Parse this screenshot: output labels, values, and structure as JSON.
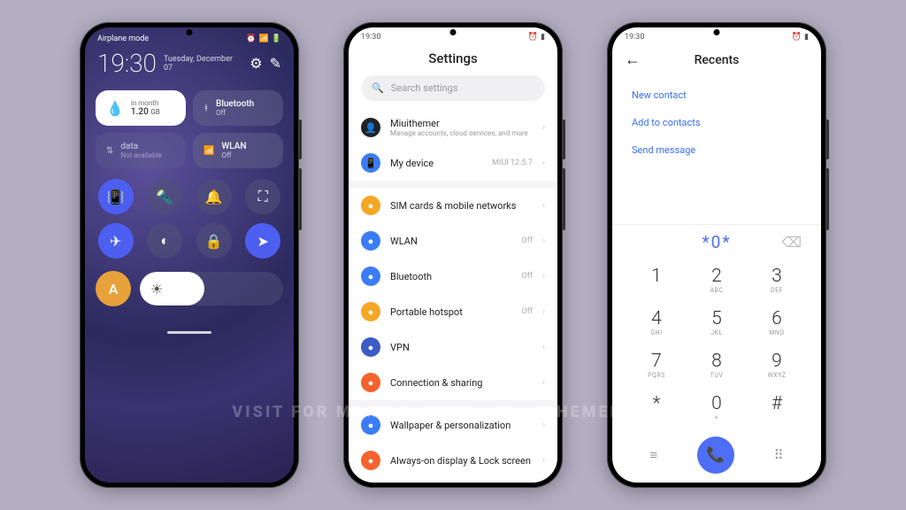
{
  "watermark": "VISIT FOR MORE THEMES - MIUITHEMER.COM",
  "p1": {
    "status_label": "Airplane mode",
    "clock": "19:30",
    "date": "Tuesday, December 07",
    "tiles": {
      "data": {
        "period": "in month",
        "value": "1.20",
        "unit": "GB"
      },
      "bluetooth": {
        "label": "Bluetooth",
        "state": "Off"
      },
      "mobile": {
        "label": "data",
        "state": "Not available"
      },
      "wlan": {
        "label": "WLAN",
        "state": "Off"
      }
    },
    "avatar_letter": "A"
  },
  "p2": {
    "clock": "19:30",
    "title": "Settings",
    "search_placeholder": "Search settings",
    "account": {
      "name": "Miuithemer",
      "sub": "Manage accounts, cloud services, and more"
    },
    "mydevice": {
      "label": "My device",
      "meta": "MIUI 12.5.7"
    },
    "items": [
      {
        "label": "SIM cards & mobile networks",
        "meta": "",
        "color": "#f5a623"
      },
      {
        "label": "WLAN",
        "meta": "Off",
        "color": "#3b7cf5"
      },
      {
        "label": "Bluetooth",
        "meta": "Off",
        "color": "#3b7cf5"
      },
      {
        "label": "Portable hotspot",
        "meta": "Off",
        "color": "#f5a623"
      },
      {
        "label": "VPN",
        "meta": "",
        "color": "#3b5cc5"
      },
      {
        "label": "Connection & sharing",
        "meta": "",
        "color": "#f5622d"
      }
    ],
    "items2": [
      {
        "label": "Wallpaper & personalization",
        "color": "#3b7cf5"
      },
      {
        "label": "Always-on display & Lock screen",
        "color": "#f5622d"
      }
    ]
  },
  "p3": {
    "clock": "19:30",
    "title": "Recents",
    "links": {
      "new": "New contact",
      "add": "Add to contacts",
      "send": "Send message"
    },
    "display": "*0*",
    "keys": [
      {
        "n": "1",
        "l": ""
      },
      {
        "n": "2",
        "l": "ABC"
      },
      {
        "n": "3",
        "l": "DEF"
      },
      {
        "n": "4",
        "l": "GHI"
      },
      {
        "n": "5",
        "l": "JKL"
      },
      {
        "n": "6",
        "l": "MNO"
      },
      {
        "n": "7",
        "l": "PQRS"
      },
      {
        "n": "8",
        "l": "TUV"
      },
      {
        "n": "9",
        "l": "WXYZ"
      },
      {
        "n": "*",
        "l": ""
      },
      {
        "n": "0",
        "l": "+"
      },
      {
        "n": "#",
        "l": ""
      }
    ]
  }
}
